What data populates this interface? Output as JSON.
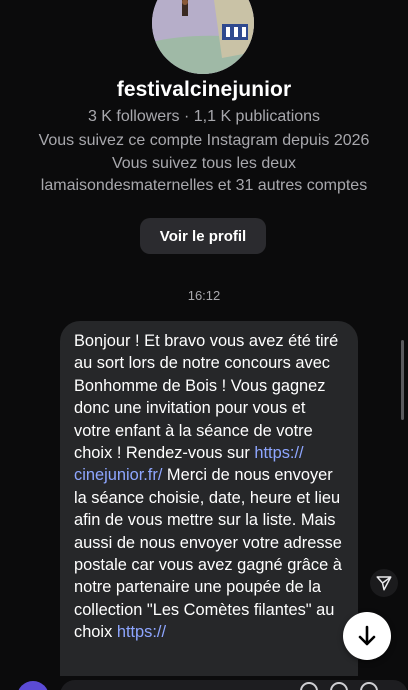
{
  "profile": {
    "username": "festivalcinejunior",
    "stats": "3 K followers · 1,1 K publications",
    "following_since": "Vous suivez ce compte Instagram depuis 2026",
    "mutuals_line1": "Vous suivez tous les deux",
    "mutuals_line2": "lamaisondesmaternelles et 31 autres comptes",
    "view_profile_label": "Voir le profil"
  },
  "thread": {
    "timestamp": "16:12"
  },
  "message": {
    "part1": "Bonjour ! Et bravo vous avez été tiré au sort lors de notre concours avec Bonhomme de Bois ! Vous gagnez donc une invitation pour vous et votre enfant à la séance de votre choix ! Rendez-vous sur ",
    "link1a": "https://",
    "link1b": "cinejunior.fr/",
    "part2": " Merci de nous envoyer la séance choisie, date, heure et lieu afin de vous mettre sur la liste. Mais aussi de nous envoyer votre adresse postale car vous avez gagné grâce à notre partenaire une poupée de la collection \"Les Comètes filantes\" au choix ",
    "link2": "https://"
  },
  "icons": {
    "share": "paper-plane-icon",
    "scroll_down": "arrow-down-icon"
  },
  "colors": {
    "background": "#0b0b0c",
    "bubble": "#262729",
    "link": "#8ea6ff",
    "secondary_text": "#a8a8ad",
    "button": "#2b2b2f"
  }
}
